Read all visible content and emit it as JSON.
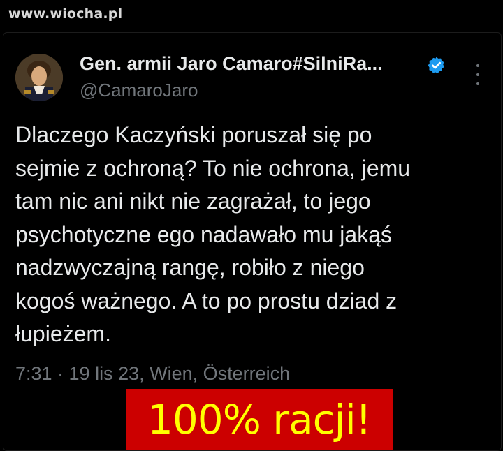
{
  "watermark": "www.wiocha.pl",
  "tweet": {
    "display_name": "Gen. armii Jaro Camaro#SilniRa...",
    "handle": "@CamaroJaro",
    "verified_icon": "verified-badge-icon",
    "more_icon": "more-vertical-icon",
    "text_lines": [
      "Dlaczego Kaczyński poruszał się po",
      "sejmie z ochroną? To nie ochrona, jemu",
      "tam nic ani nikt nie zagrażał, to jego",
      "psychotyczne ego nadawało mu jakąś",
      "nadzwyczajną rangę, robiło z niego",
      "kogoś ważnego. A to po prostu dziad z",
      "łupieżem."
    ],
    "meta": "7:31 · 19 lis 23, Wien, Österreich"
  },
  "banner": {
    "text": "100% racji!",
    "background_color": "#cc0000",
    "text_color": "#ffff00"
  },
  "colors": {
    "background": "#000000",
    "text": "#e7e9ea",
    "secondary_text": "#71767b",
    "verified_blue": "#1d9bf0"
  }
}
